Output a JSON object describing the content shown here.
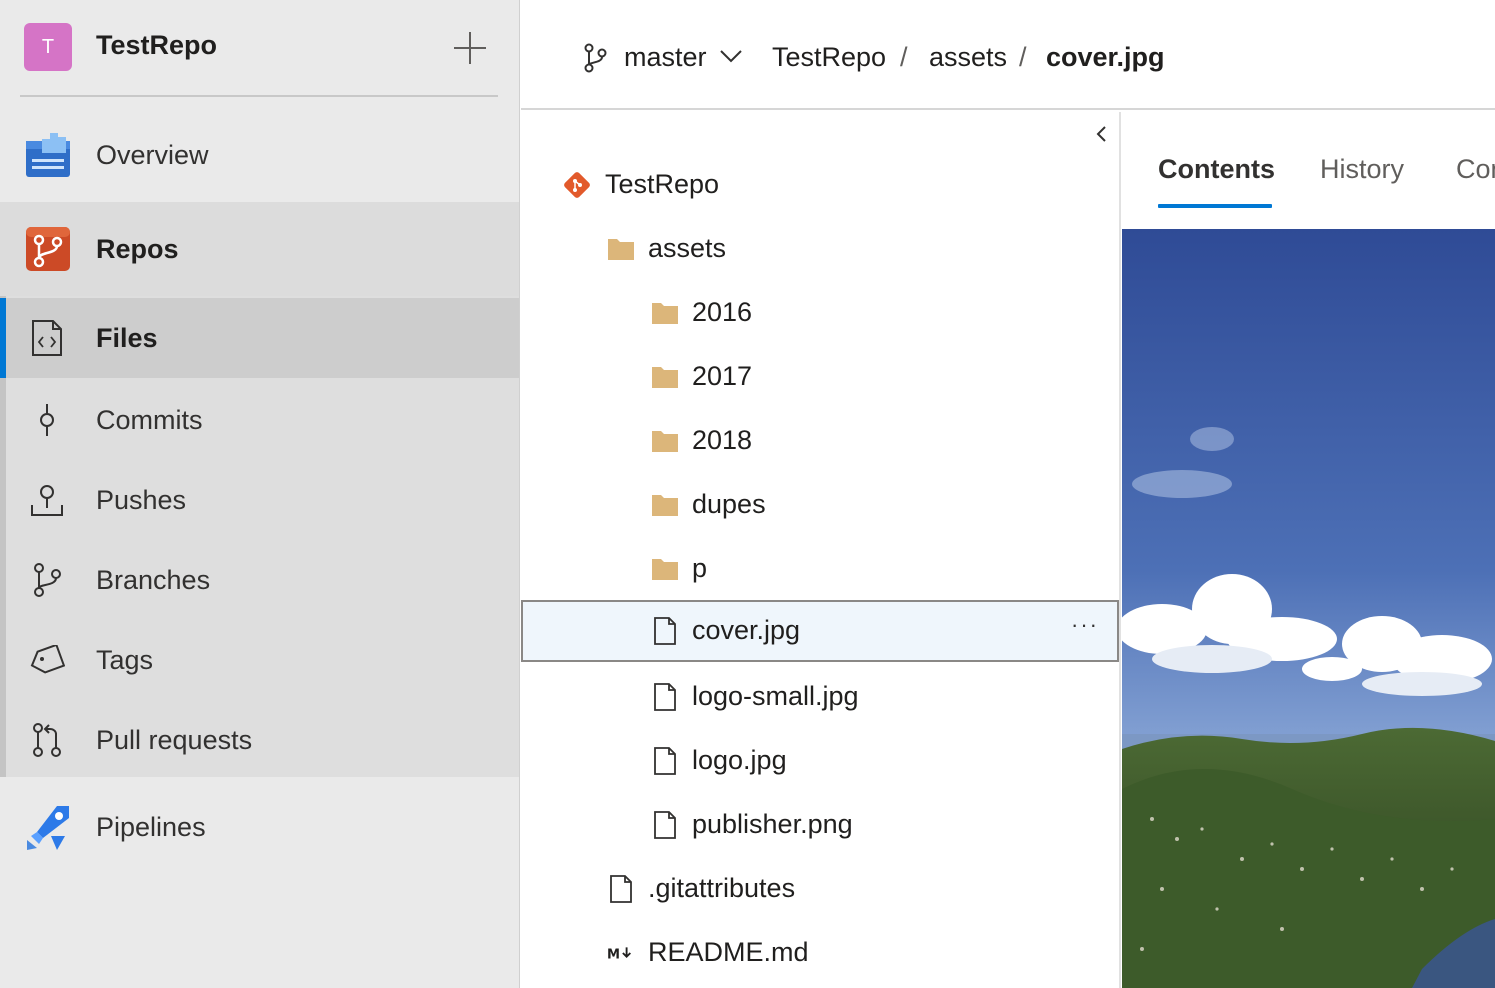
{
  "project": {
    "avatar_letter": "T",
    "name": "TestRepo",
    "avatar_color": "#d574c6"
  },
  "nav": {
    "overview": "Overview",
    "repos": "Repos",
    "files": "Files",
    "commits": "Commits",
    "pushes": "Pushes",
    "branches": "Branches",
    "tags": "Tags",
    "pull_requests": "Pull requests",
    "pipelines": "Pipelines"
  },
  "header": {
    "branch": "master",
    "breadcrumb": [
      "TestRepo",
      "assets",
      "cover.jpg"
    ],
    "separator": "/"
  },
  "tree": {
    "root": "TestRepo",
    "folder": "assets",
    "subfolders": [
      "2016",
      "2017",
      "2018",
      "dupes",
      "p"
    ],
    "files": [
      "cover.jpg",
      "logo-small.jpg",
      "logo.jpg",
      "publisher.png"
    ],
    "root_files": [
      ".gitattributes",
      "README.md"
    ],
    "selected": "cover.jpg",
    "more": "···"
  },
  "tabs": [
    "Contents",
    "History",
    "Compare"
  ],
  "colors": {
    "accent": "#0078d4",
    "folder": "#dcb67a",
    "git": "#e25a2b"
  }
}
